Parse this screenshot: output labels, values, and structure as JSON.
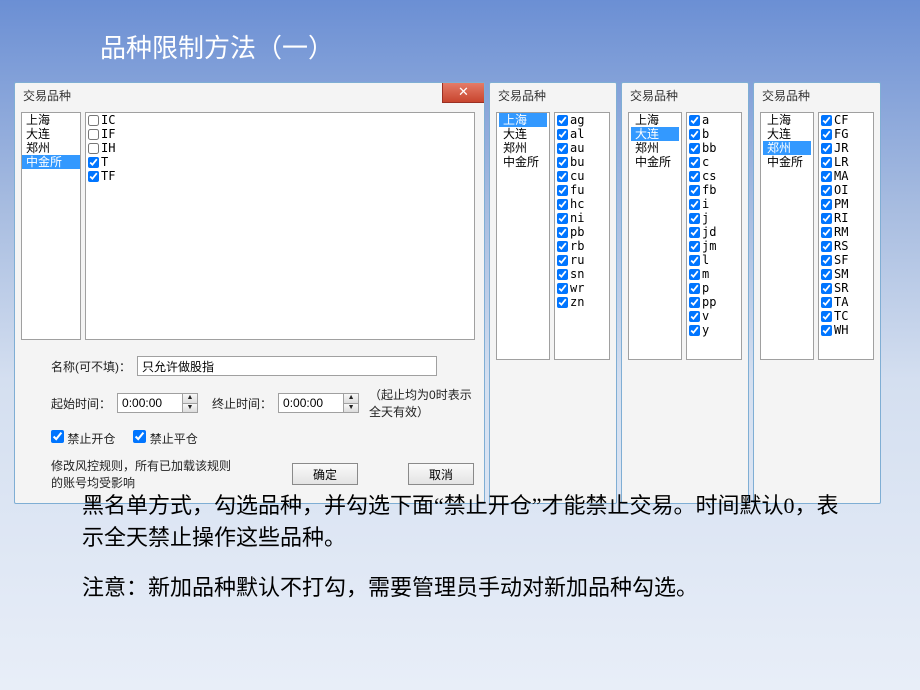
{
  "title": "品种限制方法（一）",
  "panels": {
    "main": {
      "header": "交易品种",
      "exchanges": [
        "上海",
        "大连",
        "郑州",
        "中金所"
      ],
      "selected_index": 3,
      "products": [
        {
          "label": "IC",
          "checked": false
        },
        {
          "label": "IF",
          "checked": false
        },
        {
          "label": "IH",
          "checked": false
        },
        {
          "label": "T",
          "checked": true
        },
        {
          "label": "TF",
          "checked": true
        }
      ]
    },
    "p2": {
      "header": "交易品种",
      "exchanges": [
        "上海",
        "大连",
        "郑州",
        "中金所"
      ],
      "selected_index": 0,
      "products": [
        {
          "label": "ag",
          "checked": true
        },
        {
          "label": "al",
          "checked": true
        },
        {
          "label": "au",
          "checked": true
        },
        {
          "label": "bu",
          "checked": true
        },
        {
          "label": "cu",
          "checked": true
        },
        {
          "label": "fu",
          "checked": true
        },
        {
          "label": "hc",
          "checked": true
        },
        {
          "label": "ni",
          "checked": true
        },
        {
          "label": "pb",
          "checked": true
        },
        {
          "label": "rb",
          "checked": true
        },
        {
          "label": "ru",
          "checked": true
        },
        {
          "label": "sn",
          "checked": true
        },
        {
          "label": "wr",
          "checked": true
        },
        {
          "label": "zn",
          "checked": true
        }
      ]
    },
    "p3": {
      "header": "交易品种",
      "exchanges": [
        "上海",
        "大连",
        "郑州",
        "中金所"
      ],
      "selected_index": 1,
      "products": [
        {
          "label": "a",
          "checked": true
        },
        {
          "label": "b",
          "checked": true
        },
        {
          "label": "bb",
          "checked": true
        },
        {
          "label": "c",
          "checked": true
        },
        {
          "label": "cs",
          "checked": true
        },
        {
          "label": "fb",
          "checked": true
        },
        {
          "label": "i",
          "checked": true
        },
        {
          "label": "j",
          "checked": true
        },
        {
          "label": "jd",
          "checked": true
        },
        {
          "label": "jm",
          "checked": true
        },
        {
          "label": "l",
          "checked": true
        },
        {
          "label": "m",
          "checked": true
        },
        {
          "label": "p",
          "checked": true
        },
        {
          "label": "pp",
          "checked": true
        },
        {
          "label": "v",
          "checked": true
        },
        {
          "label": "y",
          "checked": true
        }
      ]
    },
    "p4": {
      "header": "交易品种",
      "exchanges": [
        "上海",
        "大连",
        "郑州",
        "中金所"
      ],
      "selected_index": 2,
      "products": [
        {
          "label": "CF",
          "checked": true
        },
        {
          "label": "FG",
          "checked": true
        },
        {
          "label": "JR",
          "checked": true
        },
        {
          "label": "LR",
          "checked": true
        },
        {
          "label": "MA",
          "checked": true
        },
        {
          "label": "OI",
          "checked": true
        },
        {
          "label": "PM",
          "checked": true
        },
        {
          "label": "RI",
          "checked": true
        },
        {
          "label": "RM",
          "checked": true
        },
        {
          "label": "RS",
          "checked": true
        },
        {
          "label": "SF",
          "checked": true
        },
        {
          "label": "SM",
          "checked": true
        },
        {
          "label": "SR",
          "checked": true
        },
        {
          "label": "TA",
          "checked": true
        },
        {
          "label": "TC",
          "checked": true
        },
        {
          "label": "WH",
          "checked": true
        }
      ]
    }
  },
  "form": {
    "name_label": "名称(可不填)：",
    "name_value": "只允许做股指",
    "start_label": "起始时间：",
    "start_value": "0:00:00",
    "end_label": "终止时间：",
    "end_value": "0:00:00",
    "hint": "（起止均为0时表示全天有效）",
    "cb_open": "禁止开仓",
    "cb_close": "禁止平仓",
    "note": "修改风控规则，所有已加载该规则的账号均受影响",
    "ok": "确定",
    "cancel": "取消"
  },
  "explain": {
    "p1": "黑名单方式，勾选品种，并勾选下面“禁止开仓”才能禁止交易。时间默认0，表示全天禁止操作这些品种。",
    "p2": "注意：新加品种默认不打勾，需要管理员手动对新加品种勾选。"
  }
}
